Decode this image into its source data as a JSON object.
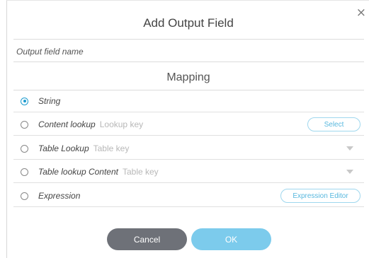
{
  "dialog": {
    "title": "Add Output Field",
    "close_icon": "×",
    "field_name_placeholder": "Output field name",
    "mapping_title": "Mapping",
    "options": [
      {
        "label": "String",
        "hint": "",
        "selected": true
      },
      {
        "label": "Content lookup",
        "hint": "Lookup key",
        "selected": false,
        "action": "Select"
      },
      {
        "label": "Table Lookup",
        "hint": "Table key",
        "selected": false,
        "control": "chevron-down-icon"
      },
      {
        "label": "Table lookup Content",
        "hint": "Table key",
        "selected": false,
        "control": "chevron-down-icon"
      },
      {
        "label": "Expression",
        "hint": "",
        "selected": false,
        "action": "Expression Editor"
      }
    ],
    "buttons": {
      "cancel": "Cancel",
      "ok": "OK"
    }
  },
  "colors": {
    "accent": "#1e9ccf",
    "ok_button": "#7ccbec",
    "cancel_button": "#6e7178"
  }
}
